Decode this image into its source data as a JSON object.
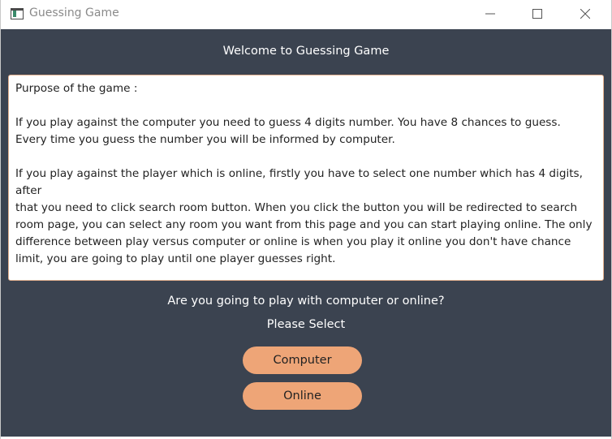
{
  "window": {
    "title": "Guessing Game"
  },
  "header": {
    "welcome": "Welcome to Guessing Game"
  },
  "description": {
    "heading": "Purpose of the game :",
    "lines_block1": [
      "If you play against the computer you need to guess 4 digits number. You have 8 chances to guess.",
      "Every time you guess the number you will be informed by computer."
    ],
    "lines_block2": [
      "If you play against the player which is online, firstly you have to select one number which has 4 digits, after",
      "that you need to click search room button. When you click the button you will be redirected to search",
      "room page, you can select any room you want from this page and you can start playing online. The only",
      "difference between play versus computer or online is when you play it online you don't have chance",
      "limit, you are going to play until one player guesses right."
    ]
  },
  "prompt": {
    "question": "Are you going to play with computer or online?",
    "select_label": "Please Select"
  },
  "buttons": {
    "computer": "Computer",
    "online": "Online"
  },
  "colors": {
    "background": "#3b4350",
    "button": "#eea577",
    "text_light": "#ffffff"
  }
}
